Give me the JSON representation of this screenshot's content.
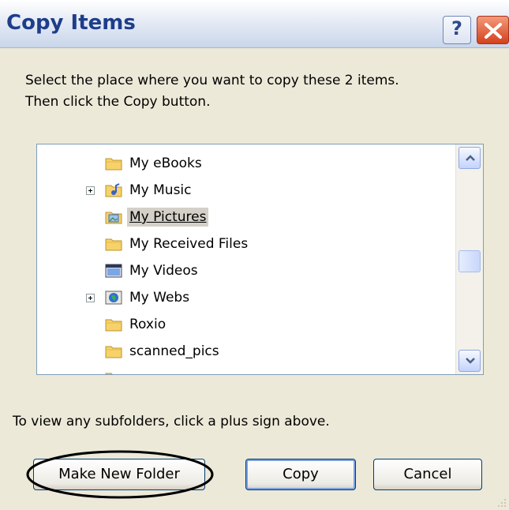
{
  "dialog": {
    "title": "Copy Items",
    "help_label": "?",
    "instruction_line1": "Select the place where you want to copy these 2 items.",
    "instruction_line2": "Then click the Copy button.",
    "hint": "To view any subfolders, click a plus sign above."
  },
  "tree": {
    "items": [
      {
        "label": "My eBooks",
        "icon": "folder-icon",
        "expandable": false,
        "selected": false
      },
      {
        "label": "My Music",
        "icon": "music-folder-icon",
        "expandable": true,
        "selected": false
      },
      {
        "label": "My Pictures",
        "icon": "pictures-folder-icon",
        "expandable": false,
        "selected": true
      },
      {
        "label": "My Received Files",
        "icon": "folder-icon",
        "expandable": false,
        "selected": false
      },
      {
        "label": "My Videos",
        "icon": "videos-folder-icon",
        "expandable": false,
        "selected": false
      },
      {
        "label": "My Webs",
        "icon": "webs-folder-icon",
        "expandable": true,
        "selected": false
      },
      {
        "label": "Roxio",
        "icon": "folder-icon",
        "expandable": false,
        "selected": false
      },
      {
        "label": "scanned_pics",
        "icon": "folder-icon",
        "expandable": false,
        "selected": false
      }
    ]
  },
  "buttons": {
    "make_new_folder": "Make New Folder",
    "copy": "Copy",
    "cancel": "Cancel"
  },
  "colors": {
    "title_text": "#1e3e8a",
    "close_button": "#d4401c",
    "dialog_bg": "#ece9d8",
    "annotation_ellipse": "#000000"
  }
}
